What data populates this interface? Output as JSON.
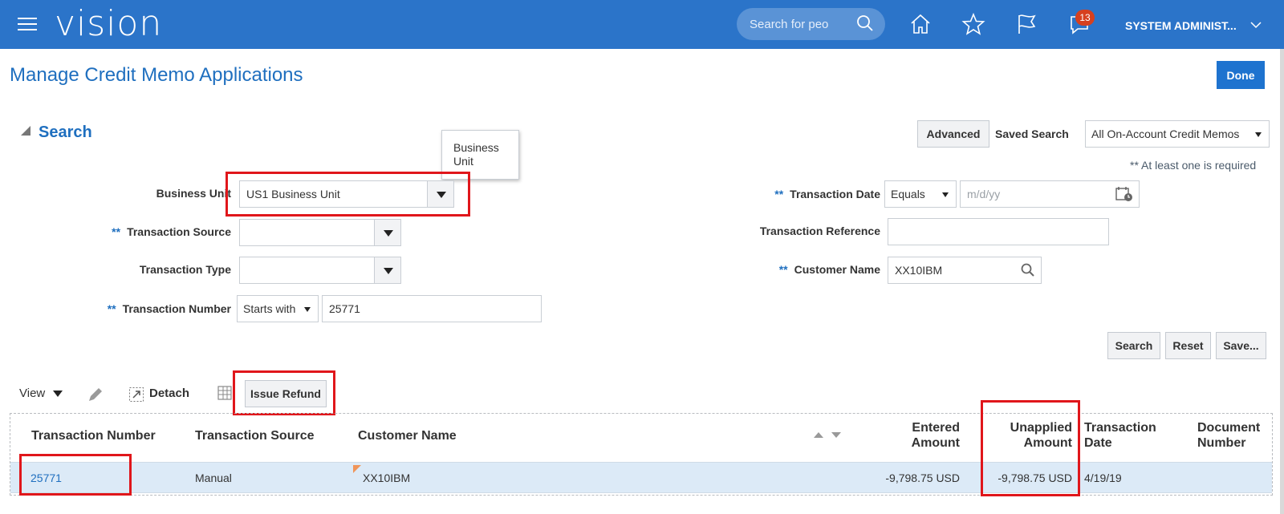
{
  "header": {
    "logo": "vision",
    "search_placeholder": "Search for peo",
    "notification_count": "13",
    "user": "SYSTEM ADMINIST..."
  },
  "page": {
    "title": "Manage Credit Memo Applications",
    "done_label": "Done"
  },
  "search": {
    "heading": "Search",
    "advanced_label": "Advanced",
    "saved_search_label": "Saved Search",
    "saved_search_value": "All On-Account Credit Memos",
    "required_note": "** At least one is required",
    "tooltip": "Business Unit",
    "required_marker": "**",
    "fields": {
      "business_unit_label": "Business Unit",
      "business_unit_value": "US1 Business Unit",
      "transaction_source_label": "Transaction Source",
      "transaction_source_value": "",
      "transaction_type_label": "Transaction Type",
      "transaction_type_value": "",
      "transaction_number_label": "Transaction Number",
      "transaction_number_operator": "Starts with",
      "transaction_number_value": "25771",
      "transaction_date_label": "Transaction Date",
      "transaction_date_operator": "Equals",
      "transaction_date_placeholder": "m/d/yy",
      "transaction_reference_label": "Transaction Reference",
      "transaction_reference_value": "",
      "customer_name_label": "Customer Name",
      "customer_name_value": "XX10IBM"
    },
    "buttons": {
      "search": "Search",
      "reset": "Reset",
      "save": "Save..."
    }
  },
  "toolbar": {
    "view": "View",
    "detach": "Detach",
    "issue_refund": "Issue Refund"
  },
  "table": {
    "columns": {
      "transaction_number": "Transaction Number",
      "transaction_source": "Transaction Source",
      "customer_name": "Customer Name",
      "entered_amount_1": "Entered",
      "entered_amount_2": "Amount",
      "unapplied_amount_1": "Unapplied",
      "unapplied_amount_2": "Amount",
      "transaction_date_1": "Transaction",
      "transaction_date_2": "Date",
      "document_number_1": "Document",
      "document_number_2": "Number"
    },
    "rows": [
      {
        "transaction_number": "25771",
        "transaction_source": "Manual",
        "customer_name": "XX10IBM",
        "entered_amount": "-9,798.75 USD",
        "unapplied_amount": "-9,798.75 USD",
        "transaction_date": "4/19/19",
        "document_number": ""
      }
    ]
  },
  "colors": {
    "header_bg": "#2b74c9",
    "accent": "#1f6fbf",
    "highlight": "#e0161b",
    "selected_row": "#dceaf7"
  }
}
